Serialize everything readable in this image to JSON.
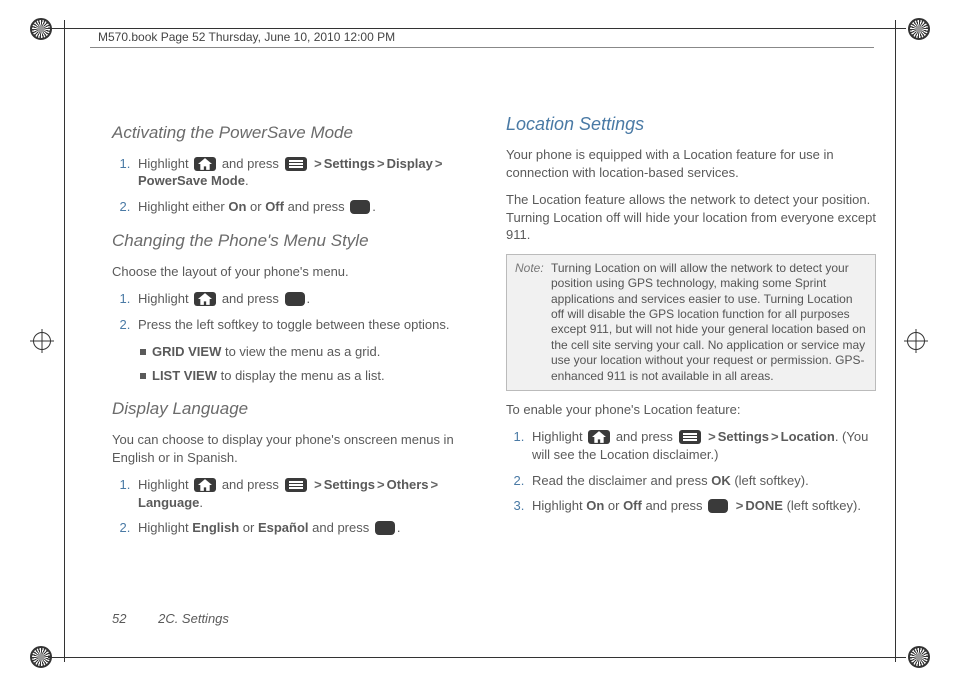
{
  "header": "M570.book  Page 52  Thursday, June 10, 2010  12:00 PM",
  "footer": {
    "page": "52",
    "section": "2C. Settings"
  },
  "glyphs": {
    "gt": ">"
  },
  "left": {
    "h1": "Activating the PowerSave Mode",
    "s1": {
      "li1a": "Highlight ",
      "li1b": " and press ",
      "li1c": "Settings",
      "li1d": "Display",
      "li1e": "PowerSave Mode",
      "li1f": ".",
      "li2a": "Highlight either ",
      "li2b": "On",
      "li2c": " or ",
      "li2d": "Off",
      "li2e": " and press ",
      "li2f": "."
    },
    "h2": "Changing the Phone's Menu Style",
    "p1": "Choose the layout of your phone's menu.",
    "s2": {
      "li1a": "Highlight ",
      "li1b": " and press ",
      "li1c": ".",
      "li2": "Press the left softkey to toggle between these options.",
      "b1a": "GRID VIEW",
      "b1b": " to view the menu as a grid.",
      "b2a": "LIST VIEW",
      "b2b": " to display the menu as a list."
    },
    "h3": "Display Language",
    "p2": "You can choose to display your phone's onscreen menus in English or in Spanish.",
    "s3": {
      "li1a": "Highlight ",
      "li1b": " and press ",
      "li1c": "Settings",
      "li1d": "Others",
      "li1e": "Language",
      "li1f": ".",
      "li2a": "Highlight ",
      "li2b": "English",
      "li2c": " or ",
      "li2d": "Español",
      "li2e": " and press ",
      "li2f": "."
    }
  },
  "right": {
    "h1": "Location Settings",
    "p1": "Your phone is equipped with a Location feature for use in connection with location-based services.",
    "p2": "The Location feature allows the network to detect your position. Turning Location off will hide your location from everyone except 911.",
    "note": {
      "label": "Note:",
      "body": "Turning Location on will allow the network to detect your position using GPS technology, making some Sprint applications and services easier to use. Turning Location off will disable the GPS location function for all purposes except 911, but will not hide your general location based on the cell site serving your call. No application or service may use your location without your request or permission. GPS-enhanced 911 is not available in all areas."
    },
    "p3": "To enable your phone's Location feature:",
    "s1": {
      "li1a": "Highlight ",
      "li1b": " and press ",
      "li1c": "Settings",
      "li1d": "Location",
      "li1e": ". (You will see the Location disclaimer.)",
      "li2a": "Read the disclaimer and press ",
      "li2b": "OK",
      "li2c": " (left softkey).",
      "li3a": "Highlight ",
      "li3b": "On",
      "li3c": " or ",
      "li3d": "Off",
      "li3e": " and press ",
      "li3f": "DONE",
      "li3g": " (left softkey)."
    }
  }
}
